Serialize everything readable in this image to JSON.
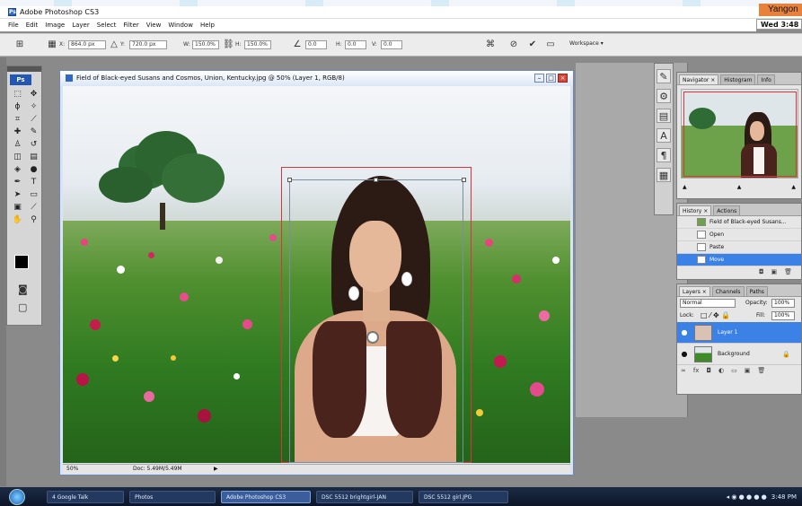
{
  "app": {
    "title": "Adobe Photoshop CS3",
    "icon_label": "Ps"
  },
  "clock": {
    "city": "Yangon",
    "time": "Wed 3:48 pm"
  },
  "menu": [
    "File",
    "Edit",
    "Image",
    "Layer",
    "Select",
    "Filter",
    "View",
    "Window",
    "Help"
  ],
  "options": {
    "x_label": "X:",
    "x_value": "864.0 px",
    "y_label": "Y:",
    "y_value": "720.0 px",
    "w_label": "W:",
    "w_value": "150.0%",
    "h_label": "H:",
    "h_value": "150.0%",
    "angle_value": "0.0",
    "h_skew": "0.0",
    "v_skew": "0.0",
    "workspace": "Workspace ▾"
  },
  "tools": {
    "logo": "Ps",
    "items": [
      "selection-marquee",
      "move",
      "lasso",
      "magic-wand",
      "crop",
      "slice",
      "healing",
      "brush",
      "clone-stamp",
      "history-brush",
      "eraser",
      "gradient",
      "blur",
      "dodge",
      "pen",
      "type",
      "path-select",
      "shape",
      "notes",
      "eyedropper",
      "hand",
      "zoom"
    ]
  },
  "document": {
    "title": "Field of Black-eyed Susans and Cosmos, Union, Kentucky.jpg @ 50% (Layer 1, RGB/8)",
    "zoom": "50%",
    "doc_size": "Doc: 5.49M/5.49M"
  },
  "panels": {
    "navigator_tabs": [
      "Navigator ×",
      "Histogram",
      "Info"
    ],
    "history_tabs": [
      "History ×",
      "Actions"
    ],
    "history_items": [
      {
        "label": "Field of Black-eyed Susans...",
        "selected": false
      },
      {
        "label": "Open",
        "selected": false
      },
      {
        "label": "Paste",
        "selected": false
      },
      {
        "label": "Move",
        "selected": true
      }
    ],
    "layers_tabs": [
      "Layers ×",
      "Channels",
      "Paths"
    ],
    "blend_mode": "Normal",
    "opacity_label": "Opacity:",
    "opacity_value": "100%",
    "lock_label": "Lock:",
    "fill_label": "Fill:",
    "fill_value": "100%",
    "layers": [
      {
        "name": "Layer 1",
        "selected": true
      },
      {
        "name": "Background",
        "selected": false
      }
    ]
  },
  "taskbar": {
    "items": [
      {
        "label": "4 Google Talk",
        "active": false
      },
      {
        "label": "Photos",
        "active": false
      },
      {
        "label": "Adobe Photoshop CS3",
        "active": true
      },
      {
        "label": "DSC 5512 brightgirl-JAN",
        "active": false
      },
      {
        "label": "DSC 5512 girl.JPG",
        "active": false
      }
    ],
    "tray_time": "3:48 PM"
  },
  "colors": {
    "selection_red": "#d8343f",
    "highlight_blue": "#3c82e6",
    "clock_orange": "#e8823a"
  }
}
